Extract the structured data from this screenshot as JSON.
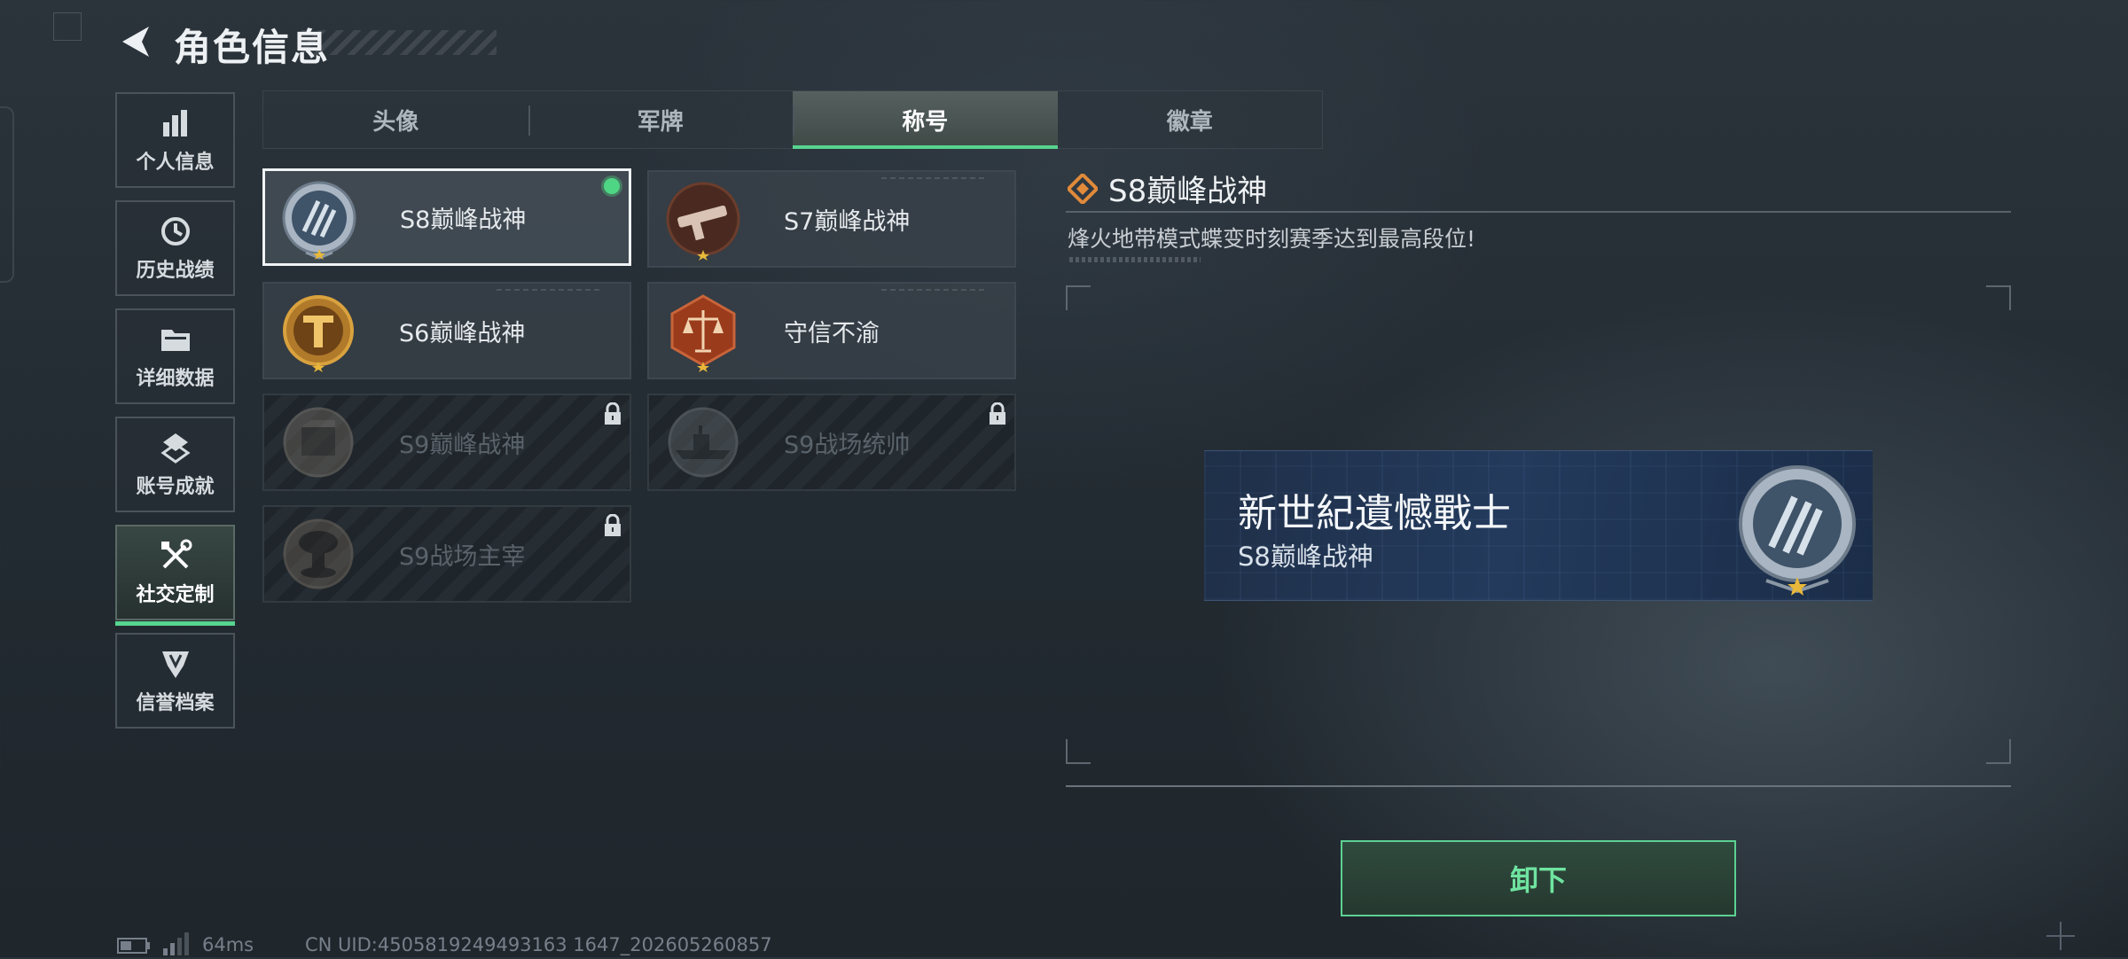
{
  "header": {
    "title": "角色信息"
  },
  "sidebar": {
    "items": [
      {
        "label": "个人信息",
        "icon": "bar-chart-icon"
      },
      {
        "label": "历史战绩",
        "icon": "history-clock-icon"
      },
      {
        "label": "详细数据",
        "icon": "folder-icon"
      },
      {
        "label": "账号成就",
        "icon": "achievement-icon"
      },
      {
        "label": "社交定制",
        "icon": "tools-icon",
        "active": true
      },
      {
        "label": "信誉档案",
        "icon": "shield-icon"
      }
    ]
  },
  "tabs": [
    {
      "label": "头像"
    },
    {
      "label": "军牌"
    },
    {
      "label": "称号",
      "active": true
    },
    {
      "label": "徽章"
    }
  ],
  "titles": [
    {
      "name": "S8巅峰战神",
      "emblem": "s8-emblem-icon",
      "selected": true,
      "equipped": true,
      "locked": false
    },
    {
      "name": "S7巅峰战神",
      "emblem": "s7-emblem-icon",
      "selected": false,
      "equipped": false,
      "locked": false
    },
    {
      "name": "S6巅峰战神",
      "emblem": "s6-emblem-icon",
      "selected": false,
      "equipped": false,
      "locked": false
    },
    {
      "name": "守信不渝",
      "emblem": "scales-emblem-icon",
      "selected": false,
      "equipped": false,
      "locked": false
    },
    {
      "name": "S9巅峰战神",
      "emblem": "s9-emblem-icon",
      "selected": false,
      "equipped": false,
      "locked": true
    },
    {
      "name": "S9战场统帅",
      "emblem": "warship-emblem-icon",
      "selected": false,
      "equipped": false,
      "locked": true
    },
    {
      "name": "S9战场主宰",
      "emblem": "mushroom-cloud-emblem-icon",
      "selected": false,
      "equipped": false,
      "locked": true
    }
  ],
  "detail": {
    "title": "S8巅峰战神",
    "description": "烽火地带模式蝶变时刻赛季达到最高段位!",
    "preview": {
      "player_name": "新世紀遺憾戰士",
      "title": "S8巅峰战神"
    },
    "unequip_label": "卸下"
  },
  "footer": {
    "ping": "64ms",
    "uid": "CN UID:4505819249493163 1647_202605260857"
  },
  "colors": {
    "accent_green": "#57d48f",
    "equipped_dot": "#4fd684",
    "background": "#252d34",
    "preview_banner": "#233a5c",
    "diamond_orange": "#e08a3a"
  }
}
